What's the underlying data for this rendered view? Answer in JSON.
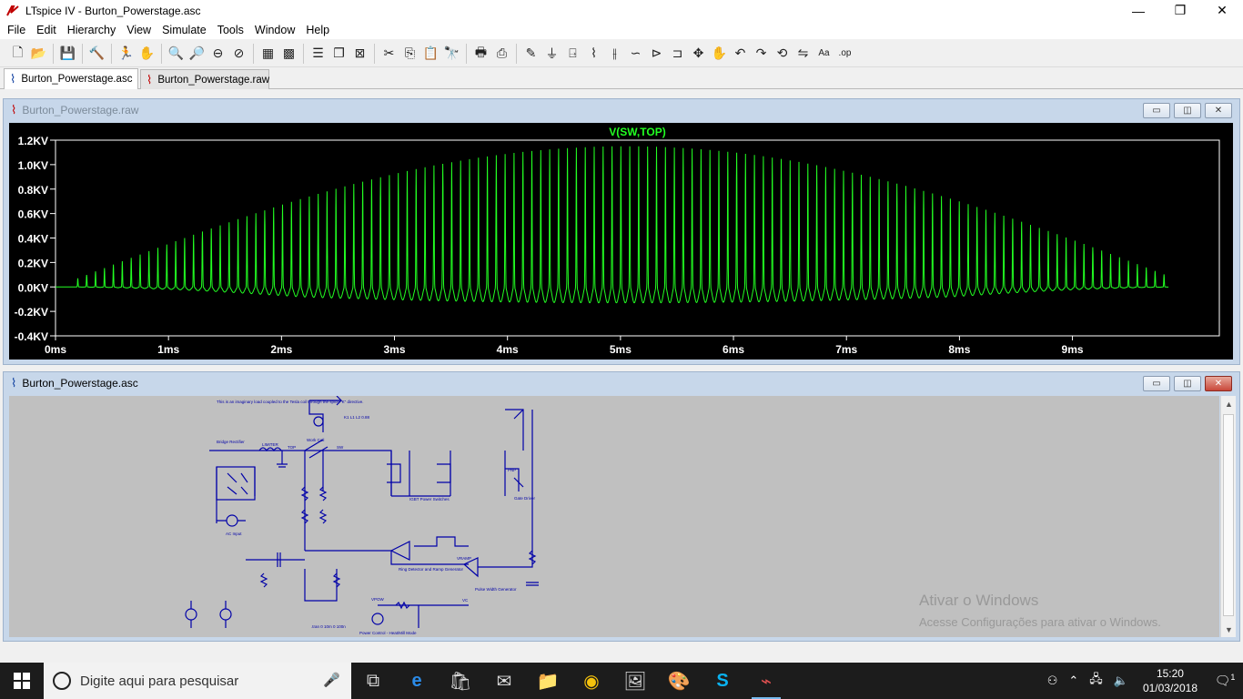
{
  "window": {
    "title": "LTspice IV - Burton_Powerstage.asc",
    "minimize": "—",
    "maximize": "❐",
    "close": "✕"
  },
  "menu": [
    {
      "label": "File",
      "key": "F"
    },
    {
      "label": "Edit",
      "key": "E"
    },
    {
      "label": "Hierarchy",
      "key": "i"
    },
    {
      "label": "View",
      "key": "V"
    },
    {
      "label": "Simulate",
      "key": "S"
    },
    {
      "label": "Tools",
      "key": "T"
    },
    {
      "label": "Window",
      "key": "W"
    },
    {
      "label": "Help",
      "key": "H"
    }
  ],
  "toolbar": [
    {
      "name": "new-schematic-icon",
      "glyph": "🗋"
    },
    {
      "name": "open-icon",
      "glyph": "📂"
    },
    {
      "sep": true
    },
    {
      "name": "save-icon",
      "glyph": "💾"
    },
    {
      "sep": true
    },
    {
      "name": "control-panel-icon",
      "glyph": "🔨"
    },
    {
      "sep": true
    },
    {
      "name": "run-icon",
      "glyph": "🏃"
    },
    {
      "name": "halt-icon",
      "glyph": "✋"
    },
    {
      "sep": true
    },
    {
      "name": "zoom-in-icon",
      "glyph": "🔍"
    },
    {
      "name": "zoom-out-icon",
      "glyph": "🔎"
    },
    {
      "name": "zoom-fit-icon",
      "glyph": "⊖"
    },
    {
      "name": "zoom-cancel-icon",
      "glyph": "⊘"
    },
    {
      "sep": true
    },
    {
      "name": "autorange-icon",
      "glyph": "▦"
    },
    {
      "name": "grid-icon",
      "glyph": "▩"
    },
    {
      "sep": true
    },
    {
      "name": "tile-horizontal-icon",
      "glyph": "☰"
    },
    {
      "name": "cascade-icon",
      "glyph": "❐"
    },
    {
      "name": "close-all-icon",
      "glyph": "⊠"
    },
    {
      "sep": true
    },
    {
      "name": "cut-icon",
      "glyph": "✂"
    },
    {
      "name": "copy-icon",
      "glyph": "⎘"
    },
    {
      "name": "paste-icon",
      "glyph": "📋"
    },
    {
      "name": "find-icon",
      "glyph": "🔭"
    },
    {
      "sep": true
    },
    {
      "name": "print-preview-icon",
      "glyph": "🖶"
    },
    {
      "name": "print-icon",
      "glyph": "⎙"
    },
    {
      "sep": true
    },
    {
      "name": "draw-wire-icon",
      "glyph": "✎"
    },
    {
      "name": "ground-icon",
      "glyph": "⏚"
    },
    {
      "name": "label-net-icon",
      "glyph": "⍈"
    },
    {
      "name": "resistor-icon",
      "glyph": "⌇"
    },
    {
      "name": "capacitor-icon",
      "glyph": "⫲"
    },
    {
      "name": "inductor-icon",
      "glyph": "∽"
    },
    {
      "name": "diode-icon",
      "glyph": "⊳"
    },
    {
      "name": "component-icon",
      "glyph": "⊐"
    },
    {
      "name": "move-icon",
      "glyph": "✥"
    },
    {
      "name": "drag-icon",
      "glyph": "✋"
    },
    {
      "name": "undo-icon",
      "glyph": "↶"
    },
    {
      "name": "redo-icon",
      "glyph": "↷"
    },
    {
      "name": "rotate-icon",
      "glyph": "⟲"
    },
    {
      "name": "mirror-icon",
      "glyph": "⇋"
    },
    {
      "name": "text-icon",
      "glyph": "Aa"
    },
    {
      "name": "spice-directive-icon",
      "glyph": ".op"
    }
  ],
  "tabs": [
    {
      "label": "Burton_Powerstage.asc",
      "icon": "schematic-tab-icon",
      "active": true
    },
    {
      "label": "Burton_Powerstage.raw",
      "icon": "waveform-tab-icon",
      "active": false
    }
  ],
  "plot_window": {
    "caption": "Burton_Powerstage.raw",
    "trace_name": "V(SW,TOP)",
    "trace_color": "#22ff22",
    "btn_min": "▭",
    "btn_max": "◫",
    "btn_close": "✕"
  },
  "chart_data": {
    "type": "line",
    "title": "V(SW,TOP)",
    "series": [
      {
        "name": "V(SW,TOP)",
        "envelope_peak_kv": 1.15,
        "carrier_cycles": 125
      }
    ],
    "x_ticks": [
      "0ms",
      "1ms",
      "2ms",
      "3ms",
      "4ms",
      "5ms",
      "6ms",
      "7ms",
      "8ms",
      "9ms"
    ],
    "y_ticks": [
      "1.2KV",
      "1.0KV",
      "0.8KV",
      "0.6KV",
      "0.4KV",
      "0.2KV",
      "0.0KV",
      "-0.2KV",
      "-0.4KV"
    ],
    "xlim_ms": [
      0,
      10.3
    ],
    "ylim_kv": [
      -0.4,
      1.2
    ],
    "grid": false,
    "background": "#000000",
    "axis_color": "#ffffff"
  },
  "schematic_window": {
    "caption": "Burton_Powerstage.asc",
    "btn_min": "▭",
    "btn_max": "◫",
    "btn_close": "✕",
    "labels": {
      "note": "This is an imaginary load coupled to the Tesla coil through the spice \"K\" directive.",
      "bridge": "Bridge Rectifier",
      "limiter": "LIMITER",
      "top": "TOP",
      "sw": "SW",
      "work_coil": "Work Coil",
      "igbt": "IGBT Power Switches",
      "gate_driver": "Gate Driver",
      "pnp": "PNP",
      "ac_input": "AC Input",
      "ring": "Ring Detector and Ramp Generator",
      "pwm": "Pulse Width Generator",
      "power_control": "Power Control - Heat/Mill Mode",
      "vramp": "VRAMP",
      "vpow": "VPOW",
      "vc": "VC",
      "k_directive": "K1 L1 L2 0.88",
      "tran": ".tran 0 10m 0 100n"
    }
  },
  "watermark": {
    "line1": "Ativar o Windows",
    "line2": "Acesse Configurações para ativar o Windows."
  },
  "taskbar": {
    "search_placeholder": "Digite aqui para pesquisar",
    "apps": [
      {
        "name": "task-view-icon",
        "glyph": "⧉",
        "open": false
      },
      {
        "name": "edge-icon",
        "glyph": "e",
        "open": false
      },
      {
        "name": "store-icon",
        "glyph": "🛍",
        "open": false
      },
      {
        "name": "mail-icon",
        "glyph": "✉",
        "open": false
      },
      {
        "name": "file-explorer-icon",
        "glyph": "📁",
        "open": false
      },
      {
        "name": "chrome-icon",
        "glyph": "◉",
        "open": false
      },
      {
        "name": "notepad-icon",
        "glyph": "🖼",
        "open": false
      },
      {
        "name": "paint-icon",
        "glyph": "🎨",
        "open": false
      },
      {
        "name": "skype-icon",
        "glyph": "S",
        "open": false
      },
      {
        "name": "ltspice-icon",
        "glyph": "⌁",
        "open": true
      }
    ],
    "time": "15:20",
    "date": "01/03/2018",
    "notification_count": "1"
  }
}
